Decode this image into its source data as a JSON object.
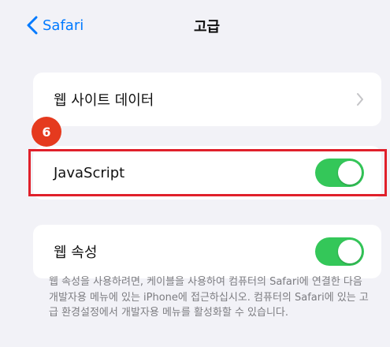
{
  "navbar": {
    "back_label": "Safari",
    "title": "고급"
  },
  "sections": {
    "website_data": {
      "label": "웹 사이트 데이터"
    },
    "javascript": {
      "label": "JavaScript",
      "toggle_on": true
    },
    "web_inspector": {
      "label": "웹 속성",
      "toggle_on": true,
      "footer": "웹 속성을 사용하려면, 케이블을 사용하여 컴퓨터의 Safari에 연결한 다음 개발자용 메뉴에 있는 iPhone에 접근하십시오. 컴퓨터의 Safari에 있는 고급 환경설정에서 개발자용 메뉴를 활성화할 수 있습니다."
    }
  },
  "annotation": {
    "step_number": "6",
    "badge_color": "#e53a1e",
    "highlight_color": "#e0202b"
  },
  "colors": {
    "accent": "#007aff",
    "toggle_on": "#34c759",
    "background": "#f2f2f7"
  }
}
